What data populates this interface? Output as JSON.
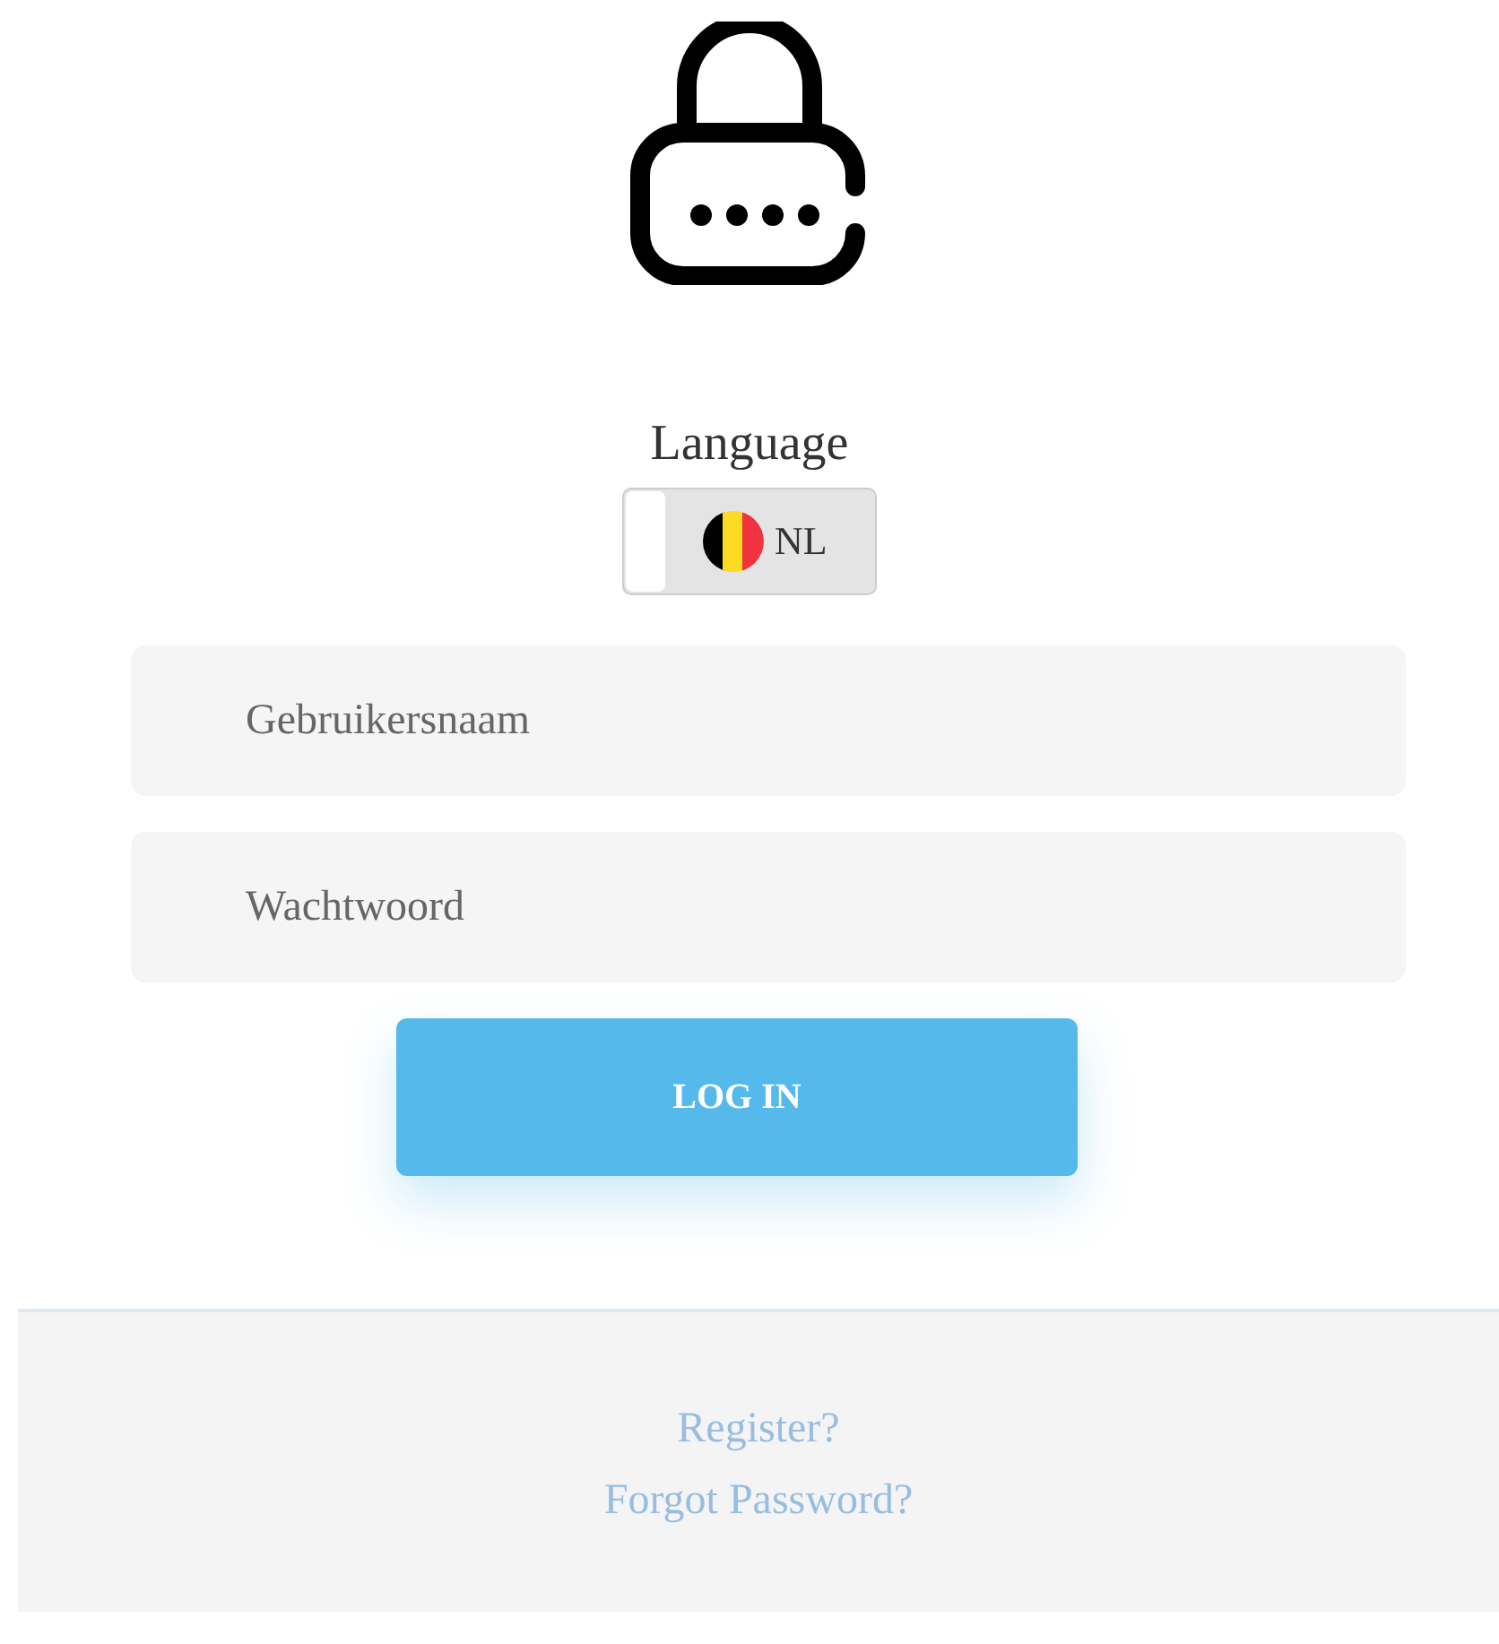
{
  "language": {
    "label": "Language",
    "toggle": {
      "on": false,
      "code": "NL"
    }
  },
  "fields": [
    {
      "placeholder": "Gebruikersnaam"
    },
    {
      "placeholder": "Wachtwoord"
    }
  ],
  "login_button": "LOG IN",
  "footer_links": [
    "Register?",
    "Forgot Password?"
  ]
}
